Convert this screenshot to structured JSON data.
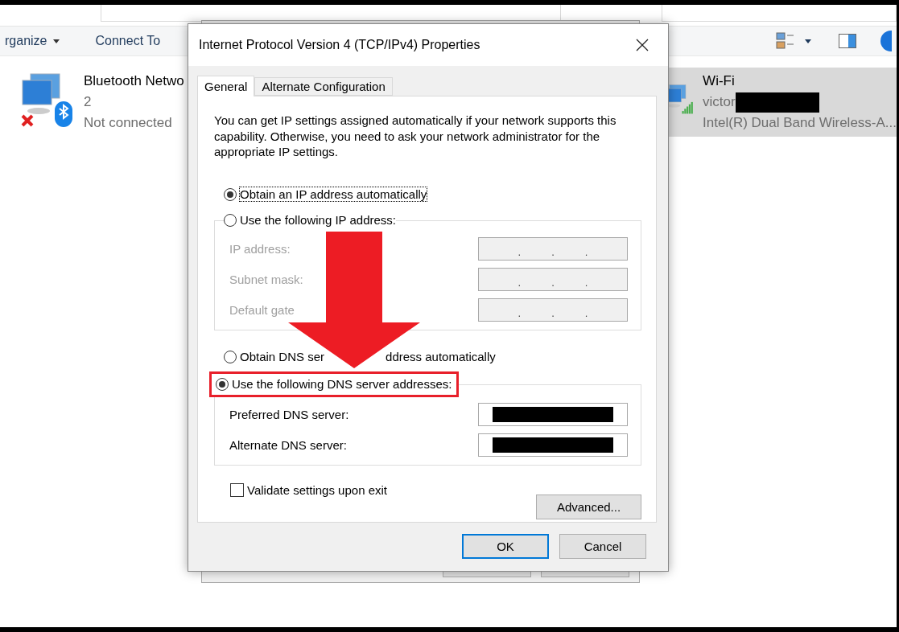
{
  "explorer": {
    "toolbar": [
      {
        "label": "rganize",
        "has_caret": true
      },
      {
        "label": "Connect To",
        "has_caret": false
      }
    ],
    "connections": [
      {
        "kind": "bluetooth",
        "name": "Bluetooth Netwo",
        "line2": "2",
        "status": "Not connected",
        "selected": false,
        "disconnected": true
      },
      {
        "kind": "wifi",
        "name": "Wi-Fi",
        "line2": "victor",
        "line2_redacted": true,
        "status": "Intel(R) Dual Band Wireless-A...",
        "selected": true,
        "disconnected": false
      }
    ]
  },
  "dialog": {
    "title": "Internet Protocol Version 4 (TCP/IPv4) Properties",
    "tabs": [
      {
        "label": "General",
        "selected": true
      },
      {
        "label": "Alternate Configuration",
        "selected": false
      }
    ],
    "intro": "You can get IP settings assigned automatically if your network supports this capability. Otherwise, you need to ask your network administrator for the appropriate IP settings.",
    "ip_options": [
      {
        "label": "Obtain an IP address automatically",
        "selected": true,
        "focused": true
      },
      {
        "label": "Use the following IP address:",
        "selected": false,
        "focused": false
      }
    ],
    "ip_fields": [
      {
        "label": "IP address:",
        "disabled": true,
        "separators": [
          ".",
          ".",
          "."
        ]
      },
      {
        "label": "Subnet mask:",
        "disabled": true,
        "separators": [
          ".",
          ".",
          "."
        ]
      },
      {
        "label": "Default gate",
        "disabled": true,
        "separators": [
          ".",
          ".",
          "."
        ]
      }
    ],
    "dns_options": [
      {
        "label": "Obtain DNS ser",
        "label_after": "ddress automatically",
        "selected": false,
        "highlighted": false
      },
      {
        "label": "Use the following DNS server addresses:",
        "selected": true,
        "highlighted": true
      }
    ],
    "dns_fields": [
      {
        "label": "Preferred DNS server:",
        "disabled": false,
        "redacted": true
      },
      {
        "label": "Alternate DNS server:",
        "disabled": false,
        "redacted": true
      }
    ],
    "validate": {
      "label": "Validate settings upon exit",
      "checked": false
    },
    "advanced_button": "Advanced...",
    "buttons": [
      {
        "label": "OK",
        "default": true
      },
      {
        "label": "Cancel",
        "default": false
      }
    ]
  }
}
